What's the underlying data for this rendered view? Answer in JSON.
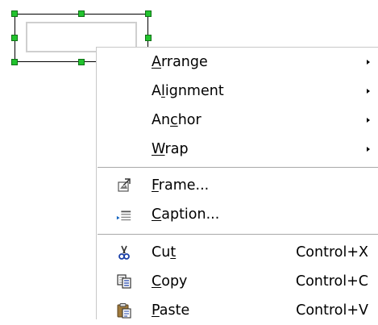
{
  "context_menu": {
    "items": [
      {
        "label": "Arrange",
        "mnemonic": "A",
        "submenu": true
      },
      {
        "label": "Alignment",
        "mnemonic": "l",
        "submenu": true
      },
      {
        "label": "Anchor",
        "mnemonic": "c",
        "submenu": true
      },
      {
        "label": "Wrap",
        "mnemonic": "W",
        "submenu": true
      },
      {
        "label": "Frame...",
        "mnemonic": "F",
        "icon": "frame-properties-icon"
      },
      {
        "label": "Caption...",
        "mnemonic": "C",
        "icon": "caption-icon"
      },
      {
        "label": "Cut",
        "mnemonic": "t",
        "shortcut": "Control+X",
        "icon": "scissors-icon"
      },
      {
        "label": "Copy",
        "mnemonic": "C",
        "shortcut": "Control+C",
        "icon": "copy-icon"
      },
      {
        "label": "Paste",
        "mnemonic": "P",
        "shortcut": "Control+V",
        "icon": "paste-icon"
      }
    ]
  },
  "colors": {
    "handle": "#22c32e",
    "separator": "#a9a9a9"
  }
}
